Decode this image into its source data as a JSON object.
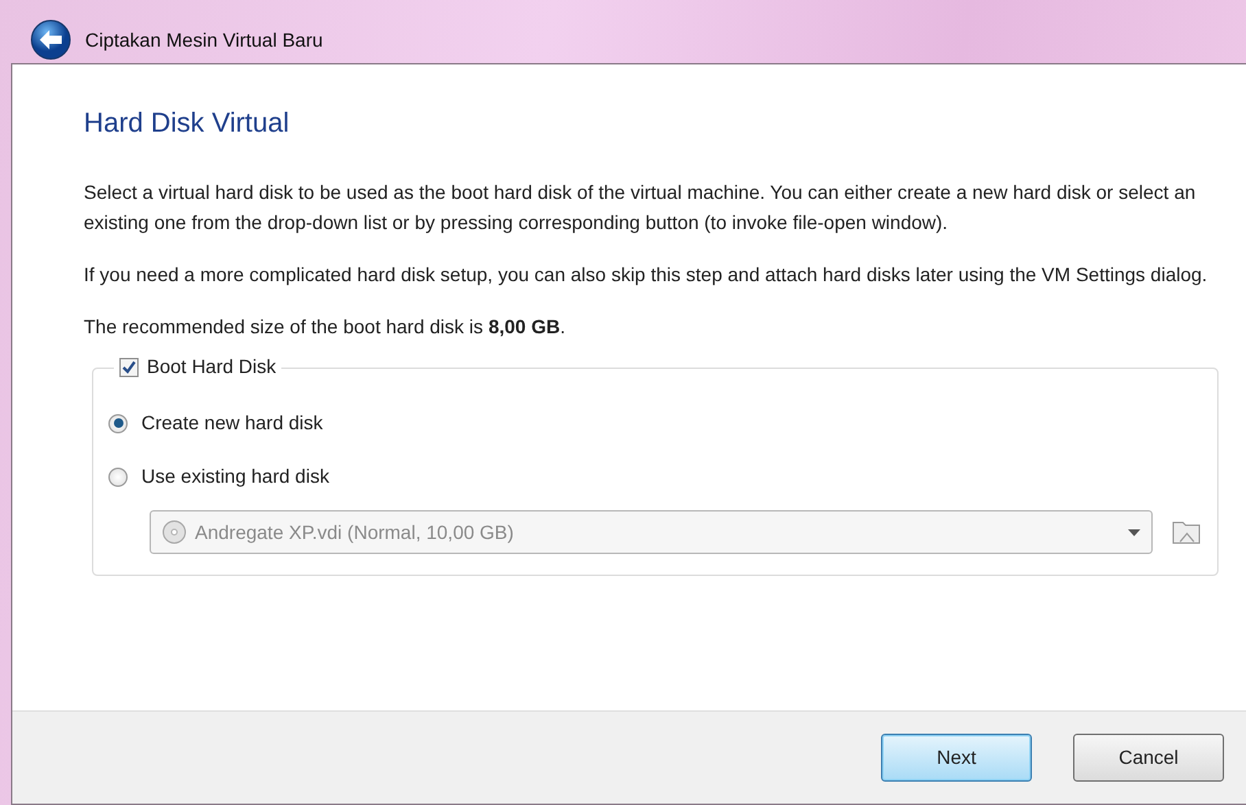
{
  "window": {
    "title": "Ciptakan Mesin Virtual Baru"
  },
  "page": {
    "heading": "Hard Disk Virtual",
    "paragraphs": [
      "Select a virtual hard disk to be used as the boot hard disk of the virtual machine. You can either create a new hard disk or select an existing one from the drop-down list or by pressing corresponding button (to invoke file-open window).",
      "If you need a more complicated hard disk setup, you can also skip this step and attach hard disks later using the VM Settings dialog.",
      "The recommended size of the boot hard disk is **8,00 GB**."
    ]
  },
  "group": {
    "label": "Boot Hard Disk",
    "checked": true,
    "options": [
      {
        "label": "Create new hard disk",
        "selected": true
      },
      {
        "label": "Use existing hard disk",
        "selected": false
      }
    ],
    "dropdown": {
      "value": "Andregate XP.vdi (Normal, 10,00 GB)",
      "disabled": true
    }
  },
  "buttons": [
    {
      "label": "Next",
      "default": true
    },
    {
      "label": "Cancel",
      "default": false
    }
  ]
}
